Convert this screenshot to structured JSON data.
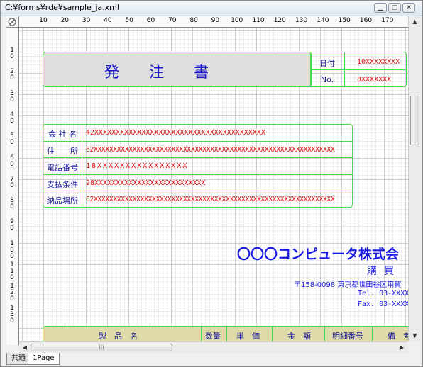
{
  "window": {
    "title": "C:¥forms¥rde¥sample_ja.xml"
  },
  "ruler": {
    "top": [
      "10",
      "20",
      "30",
      "40",
      "50",
      "60",
      "70",
      "80",
      "90",
      "100",
      "110",
      "120",
      "130",
      "140",
      "150",
      "160",
      "170"
    ],
    "left": [
      "1\n0",
      "2\n0",
      "3\n0",
      "4\n0",
      "5\n0",
      "6\n0",
      "7\n0",
      "8\n0",
      "9\n0",
      "1\n0\n0",
      "1\n1\n0",
      "1\n2\n0",
      "1\n3\n0"
    ]
  },
  "header": {
    "title": "発　　注　　書",
    "date_label": "日付",
    "date_value": "10XXXXXXXX",
    "no_label": "No.",
    "no_value": "8XXXXXXX"
  },
  "fields": [
    {
      "label": "会 社 名",
      "value": "42XXXXXXXXXXXXXXXXXXXXXXXXXXXXXXXXXXXXXXXX"
    },
    {
      "label": "住　　所",
      "value": "62XXXXXXXXXXXXXXXXXXXXXXXXXXXXXXXXXXXXXXXXXXXXXXXXXXXXXXXXXXXXXX"
    },
    {
      "label": "電話番号",
      "value": "18XXXXXXXXXXXXXXXX"
    },
    {
      "label": "支払条件",
      "value": "28XXXXXXXXXXXXXXXXXXXXXXXXXX"
    },
    {
      "label": "納品場所",
      "value": "62XXXXXXXXXXXXXXXXXXXXXXXXXXXXXXXXXXXXXXXXXXXXXXXXXXXXXXXXXXXXXX"
    }
  ],
  "vendor": {
    "company": "〇〇〇コンピュータ株式会",
    "dept": "購買",
    "address": "〒158-0098 東京都世田谷区用賀",
    "tel": "Tel. 03-XXXX-",
    "fax": "Fax. 03-XXXX-"
  },
  "table": {
    "headers": [
      "製　品　名",
      "数量",
      "単　価",
      "金　額",
      "明細番号",
      "備　考"
    ]
  },
  "tabs": [
    "共通",
    "1Page"
  ]
}
